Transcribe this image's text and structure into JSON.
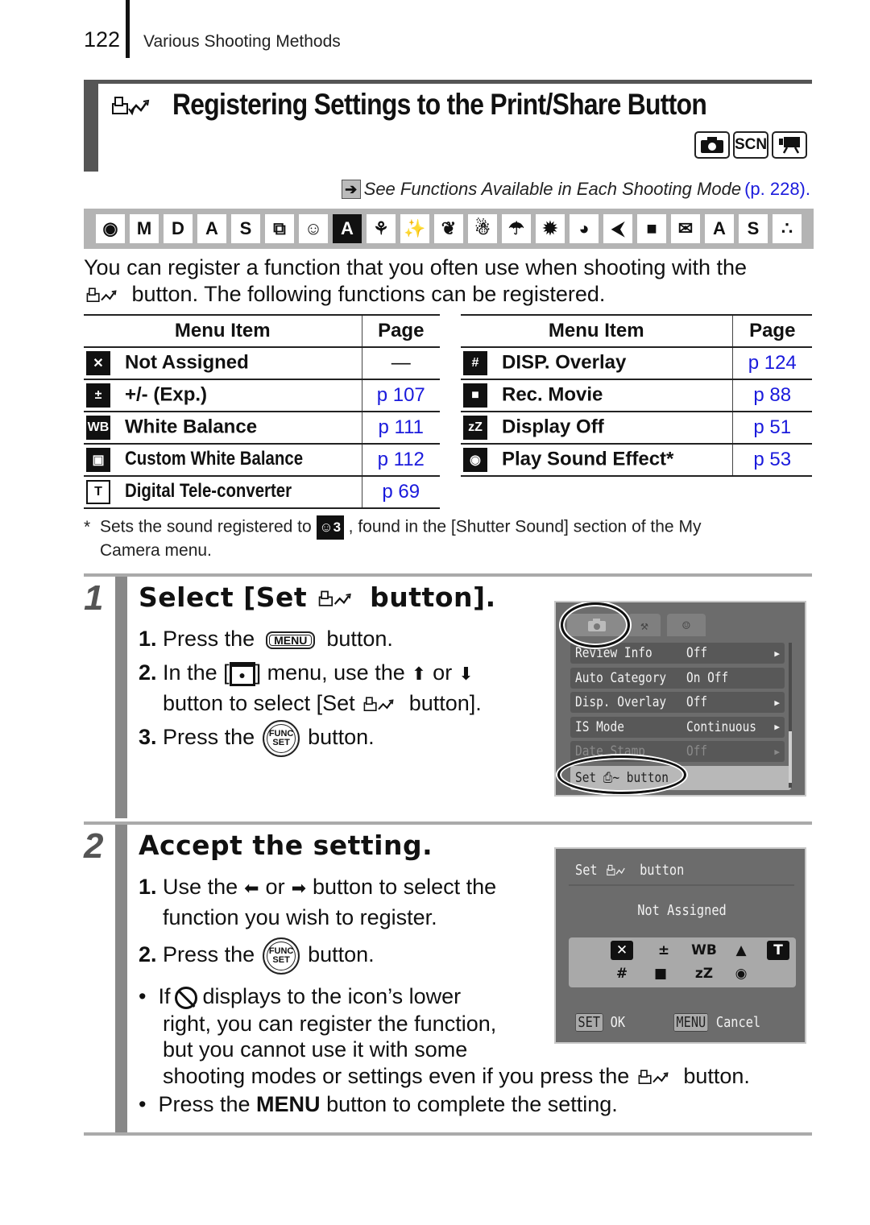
{
  "header": {
    "page_number": "122",
    "section": "Various Shooting Methods"
  },
  "title": {
    "icon": "print-share-icon",
    "text": "Registering Settings to the Print/Share Button",
    "mode_badges": [
      {
        "icon": "camera-icon",
        "label": "■"
      },
      {
        "icon": "scene-icon",
        "label": "SCN"
      },
      {
        "icon": "movie-icon",
        "label": "■"
      }
    ]
  },
  "see_also": {
    "icon": "arrow-right-icon",
    "text": "See Functions Available in Each Shooting Mode",
    "page_ref": "(p. 228)."
  },
  "mode_strip": [
    {
      "icon": "auto-mode-icon",
      "glyph": "◉",
      "dark": false
    },
    {
      "icon": "manual-mode-icon",
      "glyph": "M",
      "dark": false
    },
    {
      "icon": "digital-macro-icon",
      "glyph": "D",
      "dark": false
    },
    {
      "icon": "color-accent-icon",
      "glyph": "A",
      "dark": false
    },
    {
      "icon": "color-swap-icon",
      "glyph": "S",
      "dark": false
    },
    {
      "icon": "stitch-assist-icon",
      "glyph": "⧉",
      "dark": false
    },
    {
      "icon": "portrait-icon",
      "glyph": "☺",
      "dark": false
    },
    {
      "icon": "night-snapshot-icon",
      "glyph": "A",
      "dark": true
    },
    {
      "icon": "kids-pets-icon",
      "glyph": "⚘",
      "dark": false
    },
    {
      "icon": "indoor-party-icon",
      "glyph": "✨",
      "dark": false
    },
    {
      "icon": "foliage-icon",
      "glyph": "❦",
      "dark": false
    },
    {
      "icon": "snow-icon",
      "glyph": "☃",
      "dark": false
    },
    {
      "icon": "beach-icon",
      "glyph": "☂",
      "dark": false
    },
    {
      "icon": "fireworks-icon",
      "glyph": "✹",
      "dark": false
    },
    {
      "icon": "aquarium-icon",
      "glyph": "◕",
      "dark": false
    },
    {
      "icon": "underwater-icon",
      "glyph": "⮜",
      "dark": false
    },
    {
      "icon": "movie-standard-icon",
      "glyph": "■",
      "dark": false
    },
    {
      "icon": "movie-email-icon",
      "glyph": "✉",
      "dark": false
    },
    {
      "icon": "movie-color-accent-icon",
      "glyph": "A",
      "dark": false
    },
    {
      "icon": "movie-color-swap-icon",
      "glyph": "S",
      "dark": false
    },
    {
      "icon": "movie-time-lapse-icon",
      "glyph": "∴",
      "dark": false
    }
  ],
  "intro": {
    "line1": "You can register a function that you often use when shooting with the",
    "line2": " button. The following functions can be registered."
  },
  "table_left": {
    "headers": [
      "Menu Item",
      "Page"
    ],
    "rows": [
      {
        "icon": "not-assigned-icon",
        "glyph": "✕",
        "item": "Not Assigned",
        "page": "—",
        "condensed": false
      },
      {
        "icon": "exposure-comp-icon",
        "glyph": "±",
        "item": "+/- (Exp.)",
        "page": "p 107",
        "condensed": false
      },
      {
        "icon": "white-balance-icon",
        "glyph": "WB",
        "item": "White Balance",
        "page": "p 111",
        "condensed": false
      },
      {
        "icon": "custom-white-balance-icon",
        "glyph": "▣",
        "item": "Custom White Balance",
        "page": "p 112",
        "condensed": true
      },
      {
        "icon": "digital-tele-converter-icon",
        "glyph": "T",
        "item": "Digital Tele-converter",
        "page": "p 69",
        "condensed": true
      }
    ]
  },
  "table_right": {
    "headers": [
      "Menu Item",
      "Page"
    ],
    "rows": [
      {
        "icon": "grid-overlay-icon",
        "glyph": "#",
        "item": "DISP. Overlay",
        "page": "p 124"
      },
      {
        "icon": "movie-camera-icon",
        "glyph": "■",
        "item": "Rec. Movie",
        "page": "p 88"
      },
      {
        "icon": "display-off-icon",
        "glyph": "zZ",
        "item": "Display Off",
        "page": "p 51"
      },
      {
        "icon": "sound-effect-icon",
        "glyph": "◉",
        "item": "Play Sound Effect*",
        "page": "p 53"
      }
    ]
  },
  "footnote": {
    "marker": "*",
    "text_before": "Sets the sound registered to",
    "icon_glyph": "3",
    "text_after": ", found in the [Shutter Sound] section of the My",
    "line2": "Camera menu."
  },
  "step1": {
    "number": "1",
    "title_before": "Select [Set",
    "title_after": "button].",
    "items": [
      {
        "num": "1.",
        "before": "Press the",
        "key": "MENU",
        "after": "button."
      },
      {
        "num": "2.",
        "before": "In the [",
        "after": "] menu, use the",
        "or": "or",
        "up": "⬆",
        "down": "⬇"
      },
      {
        "num": "",
        "before": "button to select [Set",
        "after": "button]."
      },
      {
        "num": "3.",
        "before": "Press the",
        "key1": "FUNC",
        "key2": "SET",
        "after": "button."
      }
    ]
  },
  "lcd_menu": {
    "tabs": [
      "camera-tab",
      "settings-tab",
      "my-camera-tab"
    ],
    "rows": [
      {
        "label": "Review Info",
        "value": "Off",
        "state": "normal"
      },
      {
        "label": "Auto Category",
        "value": "On Off",
        "state": "normal"
      },
      {
        "label": "Disp. Overlay",
        "value": "Off",
        "state": "normal"
      },
      {
        "label": "IS Mode",
        "value": "Continuous",
        "state": "normal"
      },
      {
        "label": "Date Stamp",
        "value": "Off",
        "state": "dim"
      },
      {
        "label": "Set ⎙~ button",
        "value": "",
        "state": "selected"
      }
    ]
  },
  "step2": {
    "number": "2",
    "title": "Accept the setting.",
    "items": [
      {
        "num": "1.",
        "before": "Use the",
        "left": "⬅",
        "or": "or",
        "right": "➡",
        "after": "button to select the"
      },
      {
        "num": "",
        "text": "function you wish to register."
      },
      {
        "num": "2.",
        "before": "Press the",
        "key1": "FUNC",
        "key2": "SET",
        "after": "button."
      }
    ],
    "bullets": [
      {
        "before": "If",
        "after": "displays to the icon’s lower"
      },
      {
        "text": "right, you can register the function,"
      },
      {
        "text": "but you cannot use it with some"
      },
      {
        "text_before": "shooting modes or settings even if you press the",
        "text_after": "button."
      },
      {
        "before": "Press the",
        "bold": "MENU",
        "after": "button to complete the setting."
      }
    ]
  },
  "lcd_dialog": {
    "title_before": "Set",
    "title_after": "button",
    "current": "Not Assigned",
    "icons_row1": [
      "✕",
      "±",
      "WB",
      "▲",
      "T"
    ],
    "icons_row2": [
      "#",
      "■",
      "zZ",
      "◉"
    ],
    "ok_key": "SET",
    "ok_label": "OK",
    "cancel_key": "MENU",
    "cancel_label": "Cancel"
  },
  "colors": {
    "link": "#1a1adc",
    "title_bar": "#555555",
    "strip_bg": "#b4b4b4",
    "lcd_bg": "#6c6c6c"
  }
}
